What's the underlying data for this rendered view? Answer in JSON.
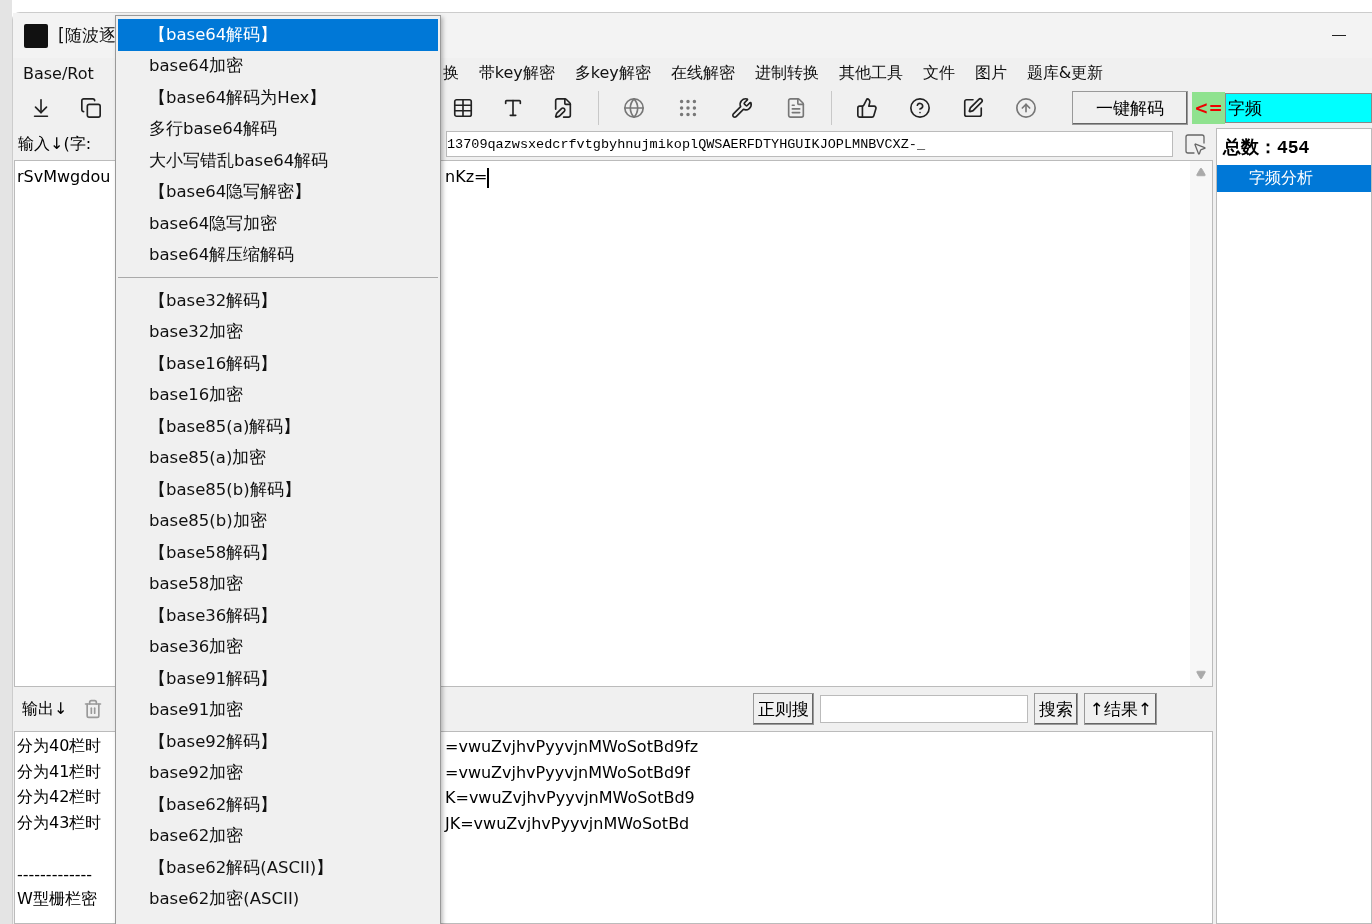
{
  "window": {
    "title": "[随波逐"
  },
  "menu_bar": [
    "Base/Rot",
    "换",
    "带key解密",
    "多key解密",
    "在线解密",
    "进制转换",
    "其他工具",
    "文件",
    "图片",
    "题库&更新"
  ],
  "toolbar": {
    "decode_button": "一键解码",
    "arrow": "<=",
    "analysis_field": "字频"
  },
  "input": {
    "label": "输入↓(字:",
    "alphabet": "13709qazwsxedcrfvtgbyhnujmikoplQWSAERFDTYHGUIKJOPLMNBVCXZ-_",
    "text_left": "rSvMwgdou",
    "text_right": "nKz="
  },
  "output": {
    "label": "输出↓",
    "regex_button": "正则搜",
    "search_button": "搜索",
    "result_button": "↑结果↑",
    "lines": [
      {
        "left": "分为40栏时",
        "right": "=vwuZvjhvPyyvjnMWoSotBd9fz"
      },
      {
        "left": "分为41栏时",
        "right": "=vwuZvjhvPyyvjnMWoSotBd9f"
      },
      {
        "left": "分为42栏时",
        "right": "K=vwuZvjhvPyyvjnMWoSotBd9"
      },
      {
        "left": "分为43栏时",
        "right": "JK=vwuZvjhvPyyvjnMWoSotBd"
      },
      {
        "left": "-------------",
        "kind": "divider"
      },
      {
        "left": "W型栅栏密"
      }
    ]
  },
  "right_panel": {
    "total": "总数：454",
    "items": [
      {
        "label": "字频分析",
        "selected": true
      }
    ]
  },
  "dropdown": {
    "items": [
      {
        "kind": "item",
        "label": "【base64解码】",
        "selected": true
      },
      {
        "kind": "item",
        "label": "base64加密",
        "selected": false
      },
      {
        "kind": "item",
        "label": "【base64解码为Hex】",
        "selected": false
      },
      {
        "kind": "item",
        "label": "多行base64解码",
        "selected": false
      },
      {
        "kind": "item",
        "label": "大小写错乱base64解码",
        "selected": false
      },
      {
        "kind": "item",
        "label": "【base64隐写解密】",
        "selected": false
      },
      {
        "kind": "item",
        "label": "base64隐写加密",
        "selected": false
      },
      {
        "kind": "item",
        "label": "base64解压缩解码",
        "selected": false
      },
      {
        "kind": "separator"
      },
      {
        "kind": "item",
        "label": "【base32解码】",
        "selected": false
      },
      {
        "kind": "item",
        "label": "base32加密",
        "selected": false
      },
      {
        "kind": "item",
        "label": "【base16解码】",
        "selected": false
      },
      {
        "kind": "item",
        "label": "base16加密",
        "selected": false
      },
      {
        "kind": "item",
        "label": "【base85(a)解码】",
        "selected": false
      },
      {
        "kind": "item",
        "label": "base85(a)加密",
        "selected": false
      },
      {
        "kind": "item",
        "label": "【base85(b)解码】",
        "selected": false
      },
      {
        "kind": "item",
        "label": "base85(b)加密",
        "selected": false
      },
      {
        "kind": "item",
        "label": "【base58解码】",
        "selected": false
      },
      {
        "kind": "item",
        "label": "base58加密",
        "selected": false
      },
      {
        "kind": "item",
        "label": "【base36解码】",
        "selected": false
      },
      {
        "kind": "item",
        "label": "base36加密",
        "selected": false
      },
      {
        "kind": "item",
        "label": "【base91解码】",
        "selected": false
      },
      {
        "kind": "item",
        "label": "base91加密",
        "selected": false
      },
      {
        "kind": "item",
        "label": "【base92解码】",
        "selected": false
      },
      {
        "kind": "item",
        "label": "base92加密",
        "selected": false
      },
      {
        "kind": "item",
        "label": "【base62解码】",
        "selected": false
      },
      {
        "kind": "item",
        "label": "base62加密",
        "selected": false
      },
      {
        "kind": "item",
        "label": "【base62解码(ASCII)】",
        "selected": false
      },
      {
        "kind": "item",
        "label": "base62加密(ASCII)",
        "selected": false
      }
    ]
  }
}
